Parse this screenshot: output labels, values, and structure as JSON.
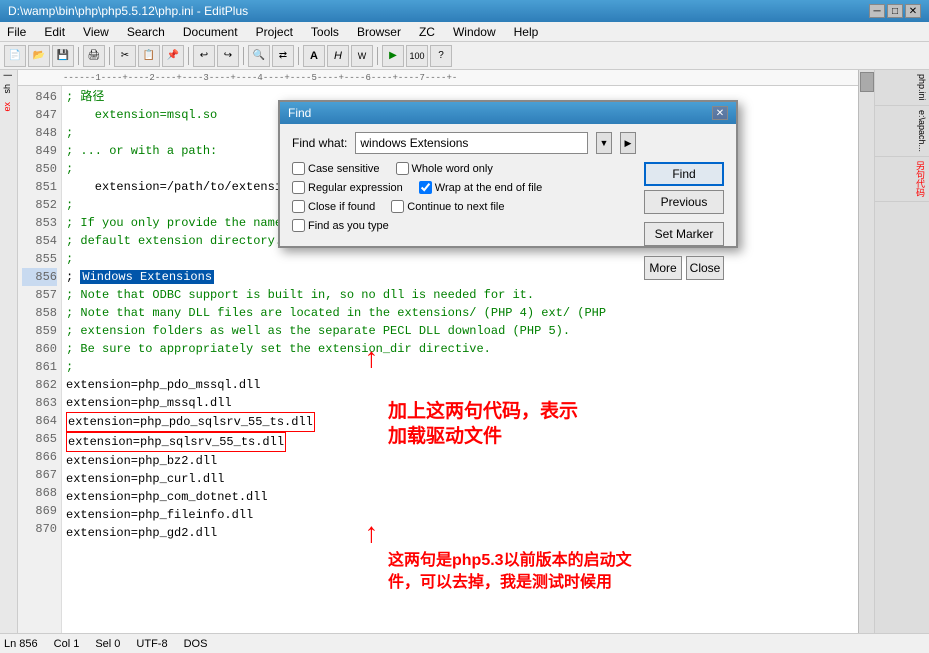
{
  "titleBar": {
    "title": "D:\\wamp\\bin\\php\\php5.5.12\\php.ini - EditPlus",
    "minimize": "─",
    "maximize": "□",
    "close": "✕"
  },
  "menuBar": {
    "items": [
      "File",
      "Edit",
      "View",
      "Search",
      "Document",
      "Project",
      "Tools",
      "Browser",
      "ZC",
      "Window",
      "Help"
    ]
  },
  "ruler": {
    "text": "------1----+----2----+----3----+----4----+----5----+----6----+----7----+-"
  },
  "lines": [
    {
      "num": "846",
      "text": "; 路径",
      "type": "comment"
    },
    {
      "num": "847",
      "text": "\t extension=msql.so",
      "type": "comment"
    },
    {
      "num": "848",
      "text": ";",
      "type": "comment"
    },
    {
      "num": "849",
      "text": "; ... or with a path:",
      "type": "comment"
    },
    {
      "num": "850",
      "text": ";",
      "type": "comment"
    },
    {
      "num": "851",
      "text": "\t extension=/path/to/extension/msql.so",
      "type": "normal"
    },
    {
      "num": "852",
      "text": ";",
      "type": "comment"
    },
    {
      "num": "853",
      "text": "; If you only provide the name of the extensio...",
      "type": "comment"
    },
    {
      "num": "854",
      "text": "; default extension directory.",
      "type": "comment"
    },
    {
      "num": "855",
      "text": ";",
      "type": "comment"
    },
    {
      "num": "856",
      "text": "; Windows Extensions",
      "type": "highlight"
    },
    {
      "num": "857",
      "text": "; Note that ODBC support is built in, so no dll is needed for it.",
      "type": "comment"
    },
    {
      "num": "858",
      "text": "; Note that many DLL files are located in the extensions/ (PHP 4) ext/ (PHP",
      "type": "comment"
    },
    {
      "num": "859",
      "text": "; extension folders as well as the separate PECL DLL download (PHP 5).",
      "type": "comment"
    },
    {
      "num": "860",
      "text": "; Be sure to appropriately set the extension_dir directive.",
      "type": "comment"
    },
    {
      "num": "861",
      "text": ";",
      "type": "comment"
    },
    {
      "num": "862",
      "text": "extension=php_pdo_mssql.dll",
      "type": "normal"
    },
    {
      "num": "863",
      "text": "extension=php_mssql.dll",
      "type": "normal"
    },
    {
      "num": "864",
      "text": "extension=php_pdo_sqlsrv_55_ts.dll",
      "type": "redborder"
    },
    {
      "num": "865",
      "text": "extension=php_sqlsrv_55_ts.dll",
      "type": "redborder"
    },
    {
      "num": "866",
      "text": "extension=php_bz2.dll",
      "type": "normal"
    },
    {
      "num": "867",
      "text": "extension=php_curl.dll",
      "type": "normal"
    },
    {
      "num": "868",
      "text": "extension=php_com_dotnet.dll",
      "type": "normal"
    },
    {
      "num": "869",
      "text": "extension=php_fileinfo.dll",
      "type": "normal"
    },
    {
      "num": "870",
      "text": "extension=php_gd2.dll",
      "type": "normal"
    }
  ],
  "findDialog": {
    "title": "Find",
    "findWhatLabel": "Find what:",
    "findWhatValue": "windows Extensions",
    "findButton": "Find",
    "previousButton": "Previous",
    "setMarkerButton": "Set Marker",
    "moreButton": "More",
    "closeButton": "Close",
    "checkboxes": {
      "caseSensitive": {
        "label": "Case sensitive",
        "checked": false
      },
      "regularExpression": {
        "label": "Regular expression",
        "checked": false
      },
      "closeIfFound": {
        "label": "Close if found",
        "checked": false
      },
      "findAsYouType": {
        "label": "Find as you type",
        "checked": false
      },
      "wholeWordOnly": {
        "label": "Whole word only",
        "checked": false
      },
      "wrapAtEnd": {
        "label": "Wrap at the end of file",
        "checked": true
      },
      "continueToNextFile": {
        "label": "Continue to next file",
        "checked": false
      }
    }
  },
  "annotations": {
    "arrow1": "↑",
    "text1": "加上这两句代码，表示\n加载驱动文件",
    "text2": "这两句是php5.3以前版本的启动文\n件，可以去掉，我是测试时候用"
  },
  "statusBar": {
    "line": "Ln 856",
    "col": "Col 1",
    "sel": "Sel 0",
    "encoding": "UTF-8",
    "type": "DOS"
  },
  "sidebarRight": {
    "items": [
      "php.ini",
      "e:\\apach...",
      "另句代码"
    ]
  }
}
